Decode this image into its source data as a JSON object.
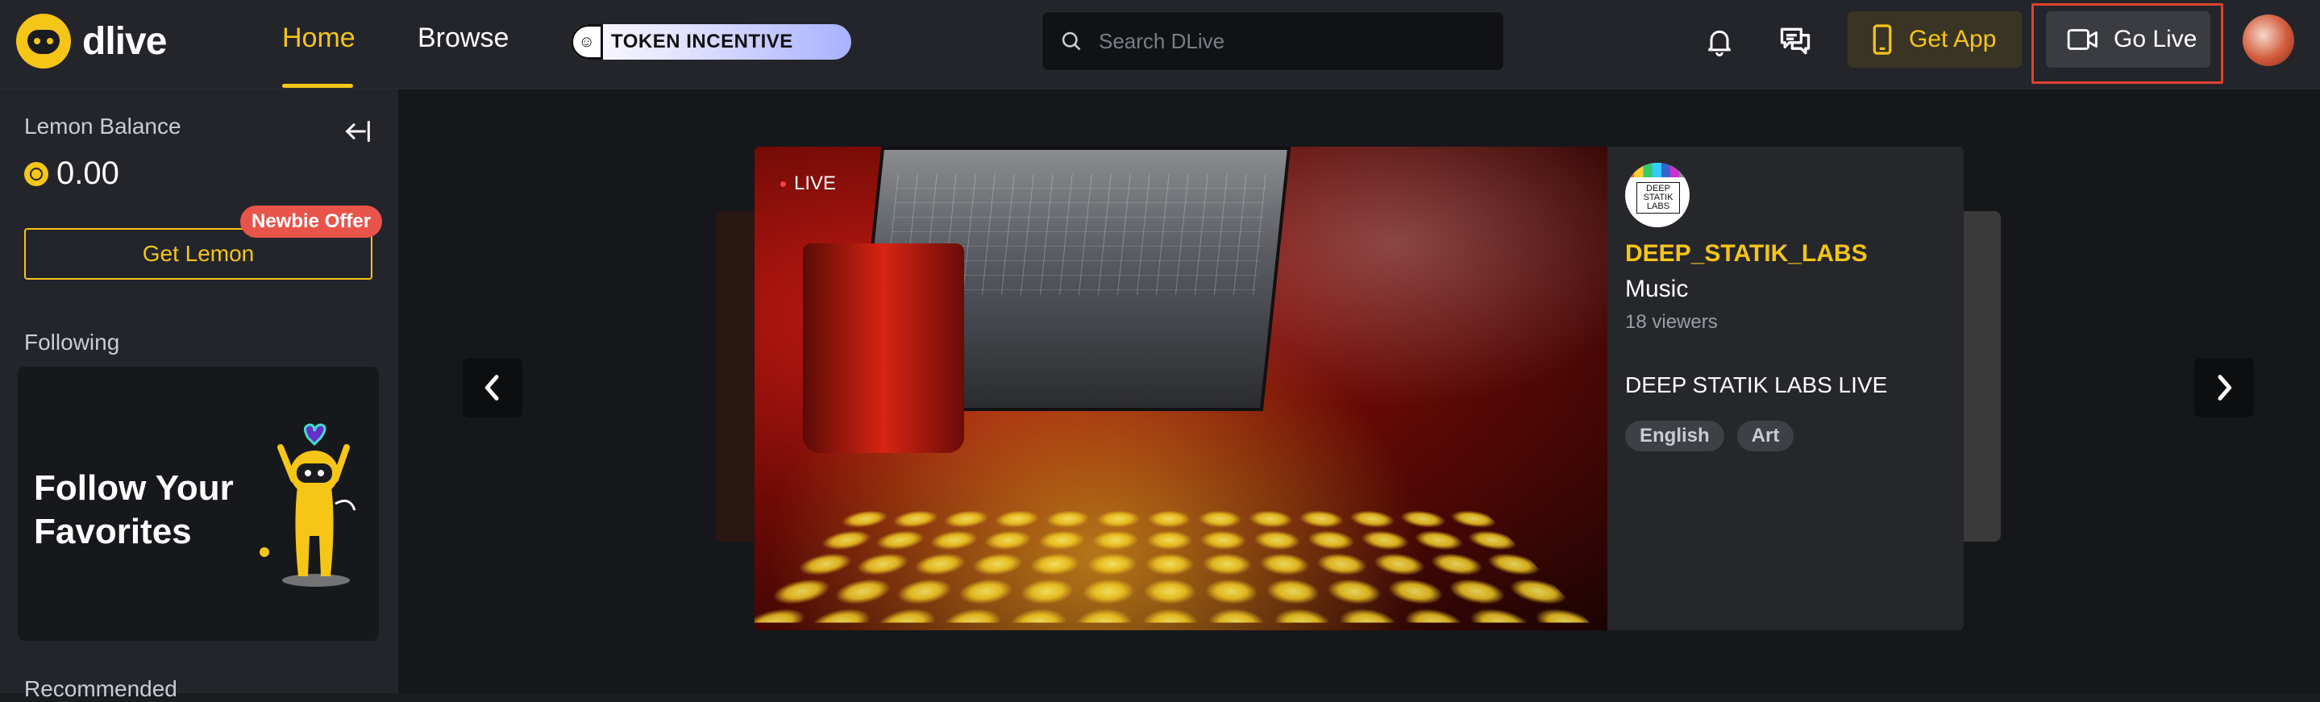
{
  "brand": {
    "name": "dlive"
  },
  "nav": {
    "home": "Home",
    "browse": "Browse",
    "token_incentive": "TOKEN INCENTIVE"
  },
  "search": {
    "placeholder": "Search DLive"
  },
  "header": {
    "get_app": "Get App",
    "go_live": "Go Live"
  },
  "sidebar": {
    "lemon_balance_label": "Lemon Balance",
    "balance_value": "0.00",
    "get_lemon": "Get Lemon",
    "newbie_offer": "Newbie Offer",
    "following_label": "Following",
    "follow_card_text": "Follow Your Favorites",
    "recommended_label": "Recommended"
  },
  "featured": {
    "live_label": "LIVE",
    "channel_avatar_text": "DEEP STATIK LABS",
    "channel_name": "DEEP_STATIK_LABS",
    "category": "Music",
    "viewers": "18 viewers",
    "title": "DEEP STATIK LABS LIVE",
    "tags": [
      "English",
      "Art"
    ]
  },
  "colors": {
    "accent": "#f5c518",
    "topbar_bg": "#23252b",
    "main_bg": "#16171a",
    "highlight_border": "#e0412d",
    "newbie_badge": "#e9544a"
  },
  "icons": {
    "search": "search-icon",
    "notifications": "bell-icon",
    "messages": "chat-icon",
    "get_app": "phone-icon",
    "go_live": "camera-icon",
    "collapse": "collapse-left-icon",
    "prev": "chevron-left-icon",
    "next": "chevron-right-icon"
  }
}
